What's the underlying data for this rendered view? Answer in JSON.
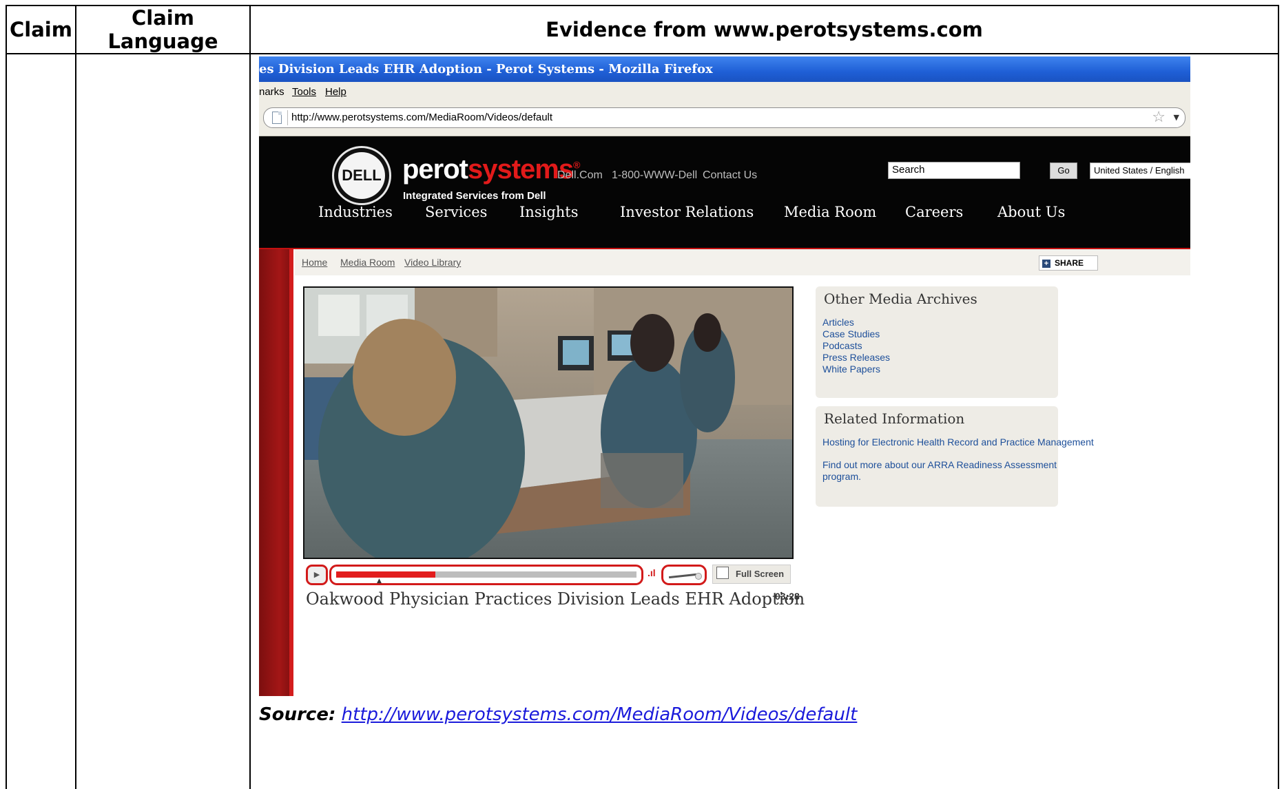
{
  "table": {
    "headers": {
      "claim": "Claim",
      "language": "Claim Language",
      "evidence": "Evidence from www.perotsystems.com"
    }
  },
  "browser": {
    "title": "es Division Leads EHR Adoption - Perot Systems - Mozilla Firefox",
    "menu": [
      "narks",
      "Tools",
      "Help"
    ],
    "url": "http://www.perotsystems.com/MediaRoom/Videos/default"
  },
  "site": {
    "logo_text": "DELL",
    "brand_a": "perot",
    "brand_b": "systems",
    "brand_mark": "®",
    "tagline": "Integrated Services from Dell",
    "util_links": [
      "Dell.Com",
      "1-800-WWW-Dell",
      "Contact Us"
    ],
    "search_placeholder": "Search",
    "go_label": "Go",
    "locale": "United States / English",
    "nav": [
      "Industries",
      "Services",
      "Insights",
      "Investor Relations",
      "Media Room",
      "Careers",
      "About Us"
    ],
    "breadcrumb": [
      "Home",
      "Media Room",
      "Video Library"
    ],
    "share_label": "SHARE",
    "video": {
      "progress": 0.33,
      "fullscreen_label": "Full Screen",
      "title": "Oakwood Physician Practices Division Leads EHR Adoption",
      "duration": "03:28"
    },
    "archives": {
      "title": "Other Media Archives",
      "links": [
        "Articles",
        "Case Studies",
        "Podcasts",
        "Press Releases",
        "White Papers"
      ]
    },
    "related": {
      "title": "Related Information",
      "links": [
        "Hosting for Electronic Health Record and Practice Management",
        "Find out more about our ARRA Readiness Assessment",
        "program."
      ]
    }
  },
  "caption": {
    "label": "Source:",
    "url": "http://www.perotsystems.com/MediaRoom/Videos/default"
  },
  "colors": {
    "brand_red": "#e11a1a",
    "highlight_red": "#d21a1a",
    "link_blue": "#1d4f9a"
  }
}
